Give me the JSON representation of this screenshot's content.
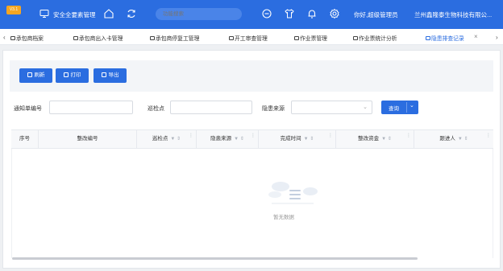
{
  "header": {
    "version": "V3.1",
    "system_title": "安全全要素管理",
    "search_placeholder": "功能搜索",
    "greeting": "你好,超级管理员",
    "company": "兰州鑫隆泰生物科技有限公..."
  },
  "tabs": [
    {
      "label": "承包商档案",
      "active": false
    },
    {
      "label": "承包商出入卡管理",
      "active": false
    },
    {
      "label": "承包商停复工管理",
      "active": false
    },
    {
      "label": "开工审查管理",
      "active": false
    },
    {
      "label": "作业票管理",
      "active": false
    },
    {
      "label": "作业票统计分析",
      "active": false
    },
    {
      "label": "隐患排查记录",
      "active": true
    }
  ],
  "toolbar": {
    "refresh_label": "刷新",
    "print_label": "打印",
    "export_label": "导出"
  },
  "filters": {
    "notice_no_label": "通知单编号",
    "notice_no_value": "",
    "checkpoint_label": "巡检点",
    "checkpoint_value": "",
    "source_label": "隐患来源",
    "source_value": "",
    "query_label": "查询"
  },
  "table": {
    "columns": [
      "序号",
      "整改编号",
      "巡检点",
      "隐患来源",
      "完成时间",
      "整改资金",
      "跟进人"
    ],
    "rows": [],
    "empty_text": "暂无数据"
  },
  "colors": {
    "primary": "#2b6de0",
    "version_badge": "#f5a623"
  }
}
